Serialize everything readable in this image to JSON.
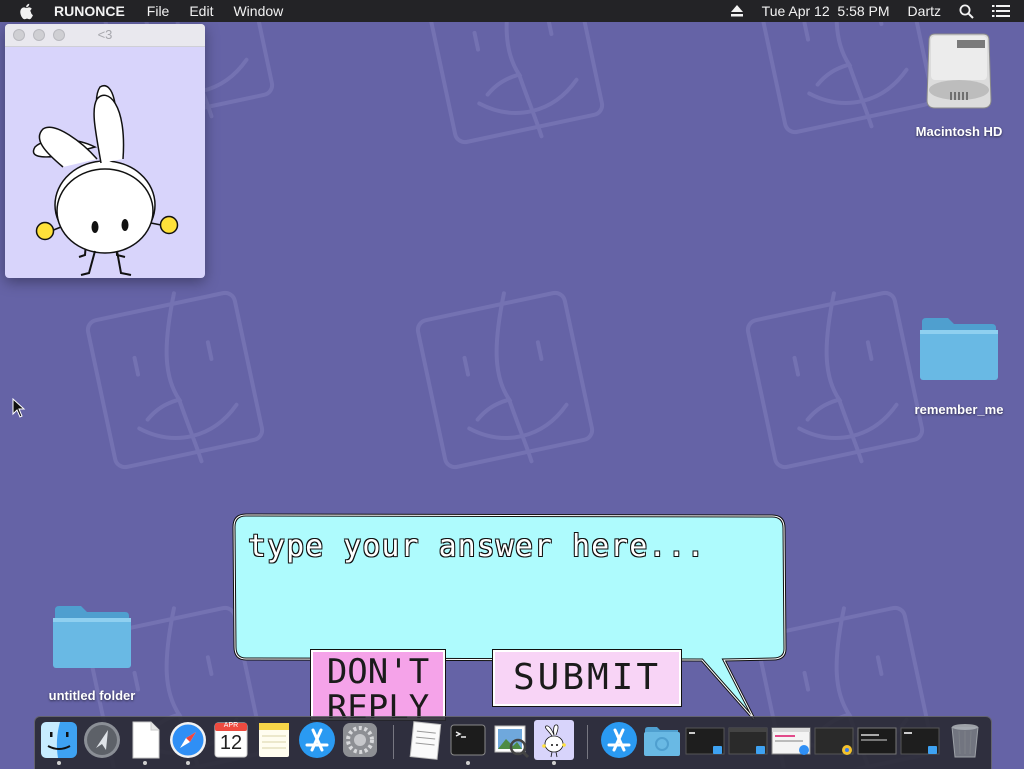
{
  "menubar": {
    "app_name": "RUNONCE",
    "menus": [
      "File",
      "Edit",
      "Window"
    ],
    "datetime": "Tue Apr 12  5:58 PM",
    "user": "Dartz"
  },
  "mini_window": {
    "title": "<3"
  },
  "desktop_icons": {
    "hd": "Macintosh HD",
    "remember": "remember_me",
    "untitled": "untitled folder"
  },
  "dialog": {
    "placeholder": "type your answer here...",
    "dont_reply": "DON'T REPLY",
    "submit": "SUBMIT"
  },
  "dock": {
    "calendar_month": "APR",
    "calendar_day": "12",
    "items": [
      "finder-icon",
      "launchpad-icon",
      "document-icon",
      "safari-icon",
      "calendar-icon",
      "notes-icon",
      "app-store-icon",
      "system-preferences-icon",
      "textedit-icon",
      "terminal-icon",
      "preview-icon",
      "runonce-bunny-icon",
      "app-store-download-icon",
      "folder-icon",
      "window-thumbnail-icon",
      "trash-icon"
    ]
  },
  "colors": {
    "desktop": "#6563a6",
    "bubble": "#aefbfd",
    "dont_reply": "#f5a3e9",
    "submit": "#f8d4f6",
    "window": "#d8d4fb"
  }
}
